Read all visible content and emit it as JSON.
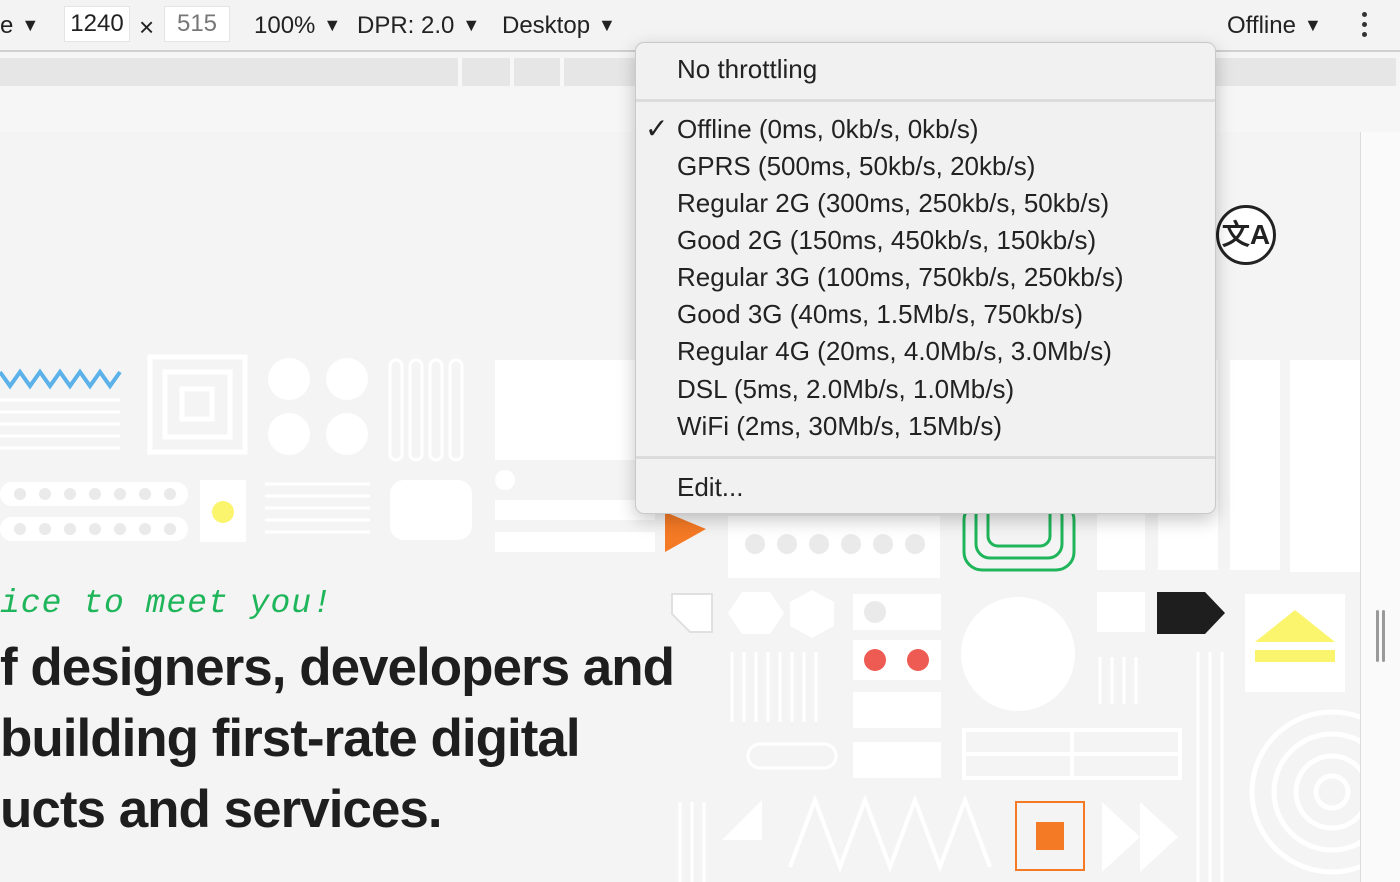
{
  "toolbar": {
    "device_fragment": "e",
    "width_value": "1240",
    "times_symbol": "×",
    "height_value": "515",
    "zoom_label": "100%",
    "dpr_label": "DPR: 2.0",
    "mode_label": "Desktop",
    "throttle_label": "Offline",
    "caret": "▼"
  },
  "page": {
    "tagline": "ice to meet you!",
    "headline_lines": [
      "f designers, developers and",
      "building first-rate digital",
      "ucts and services."
    ],
    "translate_glyph": "文A"
  },
  "menu": {
    "top_item": "No throttling",
    "selected_index": 0,
    "check_glyph": "✓",
    "options": [
      "Offline (0ms, 0kb/s, 0kb/s)",
      "GPRS (500ms, 50kb/s, 20kb/s)",
      "Regular 2G (300ms, 250kb/s, 50kb/s)",
      "Good 2G (150ms, 450kb/s, 150kb/s)",
      "Regular 3G (100ms, 750kb/s, 250kb/s)",
      "Good 3G (40ms, 1.5Mb/s, 750kb/s)",
      "Regular 4G (20ms, 4.0Mb/s, 3.0Mb/s)",
      "DSL (5ms, 2.0Mb/s, 1.0Mb/s)",
      "WiFi (2ms, 30Mb/s, 15Mb/s)"
    ],
    "edit_item": "Edit..."
  },
  "colors": {
    "tagline_green": "#1fb55a",
    "accent_orange": "#f47a25",
    "accent_yellow": "#fbf46d",
    "accent_blue": "#5bb1e8",
    "accent_red": "#ee5b52"
  }
}
